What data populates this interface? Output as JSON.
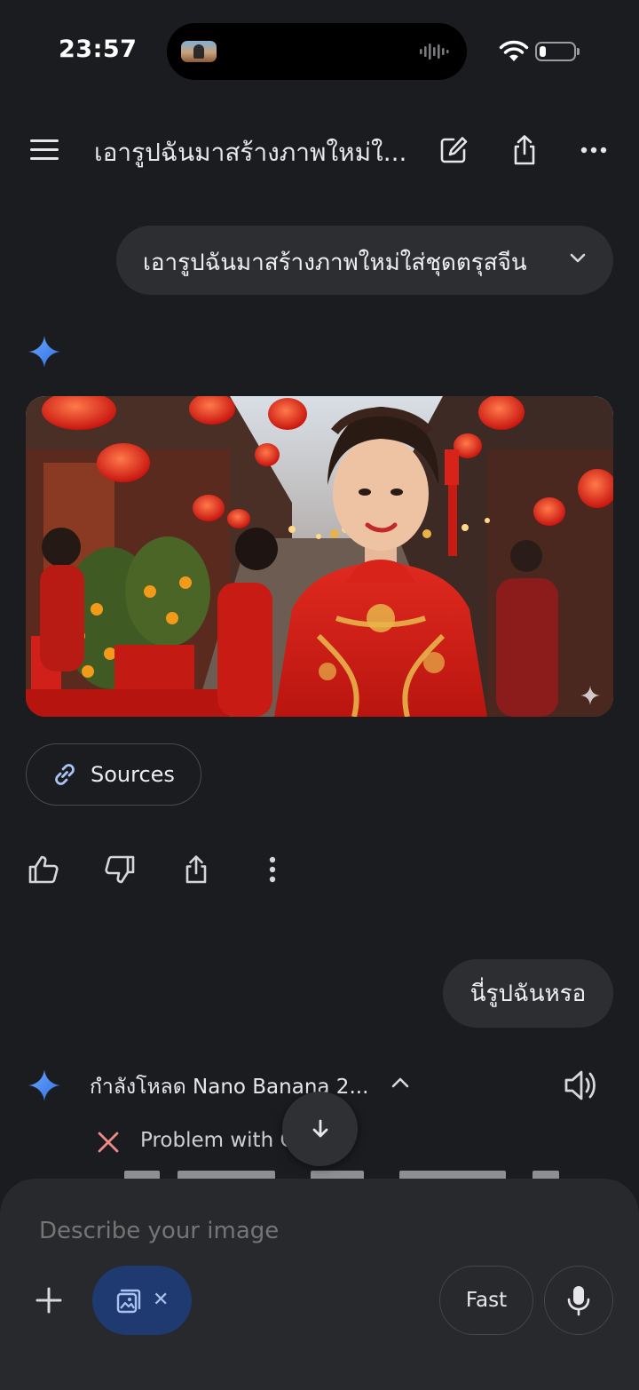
{
  "status_bar": {
    "time": "23:57",
    "battery_level": 0.2
  },
  "header": {
    "title": "เอารูปฉันมาสร้างภาพใหม่ใ...",
    "icons": [
      "menu-icon",
      "edit-icon",
      "share-icon",
      "more-icon"
    ]
  },
  "conversation": {
    "user_message_1": "เอารูปฉันมาสร้างภาพใหม่ใส่ชุดตรุสจีน",
    "sources_label": "Sources",
    "feedback_icons": [
      "thumbs-up-icon",
      "thumbs-down-icon",
      "share-icon",
      "more-vertical-icon"
    ],
    "user_message_2": "นี่รูปฉันหรอ",
    "loading_status": "กำลังโหลด Nano Banana 2...",
    "problem_text": "Problem with C"
  },
  "composer": {
    "placeholder": "Describe your image",
    "mode_label": "Fast",
    "chip_close": "✕"
  },
  "colors": {
    "background": "#1b1c1f",
    "bubble": "#2d2e31",
    "composer": "#28292c",
    "chip": "#1e3a70",
    "gemini_blue": "#4a8ff7",
    "error_red": "#f08a8a"
  }
}
